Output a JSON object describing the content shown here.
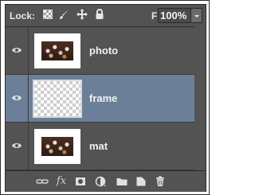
{
  "topbar": {
    "lock_label": "Lock:",
    "fill_label": "Fill:",
    "fill_value": "100%"
  },
  "layers": [
    {
      "name": "photo",
      "selected": false,
      "visible": true
    },
    {
      "name": "frame",
      "selected": true,
      "visible": true
    },
    {
      "name": "mat",
      "selected": false,
      "visible": true
    }
  ],
  "colors": {
    "panel_bg": "#535353",
    "selected_row": "#6b7f98",
    "text": "#f2f2f2"
  },
  "icons": {
    "lock": [
      "lock-transparent-icon",
      "lock-image-brush-icon",
      "lock-position-move-icon",
      "lock-all-icon"
    ],
    "bottom": [
      "link-layers-icon",
      "fx-layer-style-icon",
      "add-mask-icon",
      "adjustment-layer-icon",
      "new-group-folder-icon",
      "new-layer-icon",
      "delete-layer-trash-icon"
    ]
  },
  "bottom_fx_label": "fx"
}
